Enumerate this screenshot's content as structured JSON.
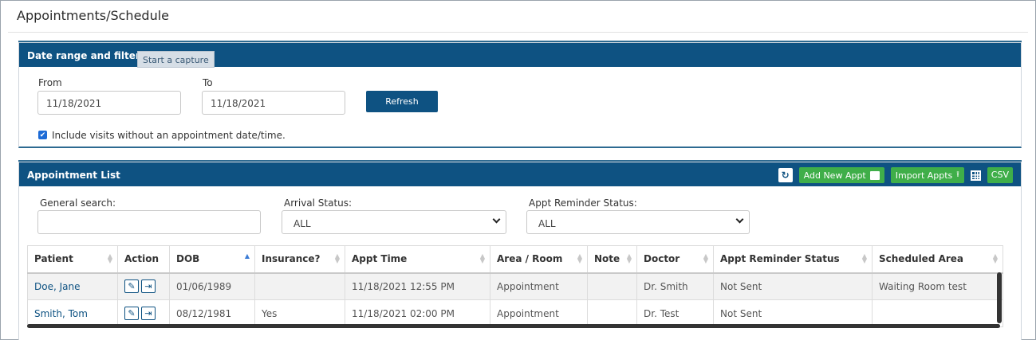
{
  "page": {
    "title": "Appointments/Schedule"
  },
  "filter": {
    "header": "Date range and filter",
    "tooltip": "Start a capture",
    "from_label": "From",
    "from_value": "11/18/2021",
    "to_label": "To",
    "to_value": "11/18/2021",
    "refresh_label": "Refresh",
    "include_visits_checked": true,
    "include_visits_label": "Include visits without an appointment date/time."
  },
  "list": {
    "header": "Appointment List",
    "tools": {
      "refresh_icon": "refresh-icon",
      "add_label": "Add New Appt",
      "import_label": "Import Appts",
      "grid_icon": "table-grid-icon",
      "csv_label": "CSV"
    },
    "general_search_label": "General search:",
    "general_search_value": "",
    "arrival_status_label": "Arrival Status:",
    "arrival_status_value": "ALL",
    "reminder_status_label": "Appt Reminder Status:",
    "reminder_status_value": "ALL",
    "columns": [
      "Patient",
      "Action",
      "DOB",
      "Insurance?",
      "Appt Time",
      "Area / Room",
      "Note",
      "Doctor",
      "Appt Reminder Status",
      "Scheduled Area"
    ],
    "rows": [
      {
        "patient": "Doe, Jane",
        "dob": "01/06/1989",
        "insurance": "",
        "appt_time": "11/18/2021 12:55 PM",
        "area": "Appointment",
        "note": "",
        "doctor": "Dr. Smith",
        "reminder": "Not Sent",
        "scheduled_area": "Waiting Room test"
      },
      {
        "patient": "Smith, Tom",
        "dob": "08/12/1981",
        "insurance": "Yes",
        "appt_time": "11/18/2021 02:00 PM",
        "area": "Appointment",
        "note": "",
        "doctor": "Dr. Test",
        "reminder": "Not Sent",
        "scheduled_area": ""
      }
    ]
  },
  "colors": {
    "header_blue": "#0e5282",
    "green_button": "#3fae49",
    "checkbox_blue": "#1d6bd6"
  }
}
